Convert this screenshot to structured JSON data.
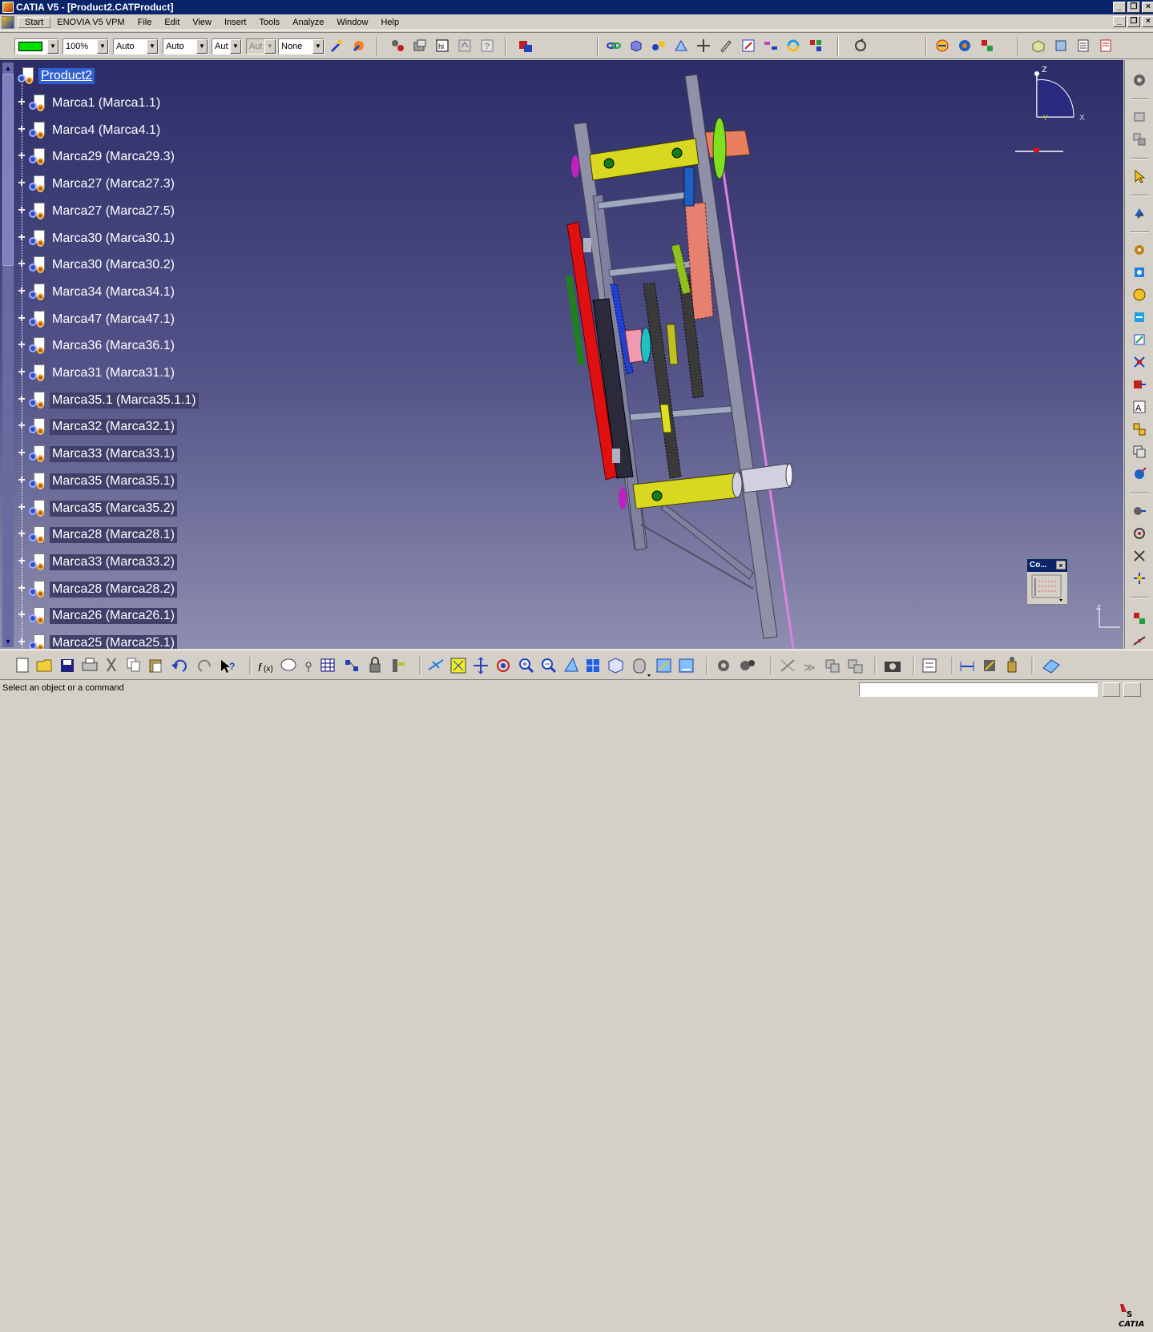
{
  "window": {
    "title": "CATIA V5 - [Product2.CATProduct]"
  },
  "menu": {
    "items": [
      "Start",
      "ENOVIA V5 VPM",
      "File",
      "Edit",
      "View",
      "Insert",
      "Tools",
      "Analyze",
      "Window",
      "Help"
    ]
  },
  "toolbar": {
    "zoom_value": "100%",
    "linetype_value": "Auto",
    "thickness_value": "Auto",
    "layer_value": "Aut",
    "layer2_value": "Aut",
    "render_value": "None",
    "color_value": "#00e000"
  },
  "tree": {
    "root": "Product2",
    "items": [
      "Marca1 (Marca1.1)",
      "Marca4 (Marca4.1)",
      "Marca29 (Marca29.3)",
      "Marca27 (Marca27.3)",
      "Marca27 (Marca27.5)",
      "Marca30 (Marca30.1)",
      "Marca30 (Marca30.2)",
      "Marca34 (Marca34.1)",
      "Marca47 (Marca47.1)",
      "Marca36 (Marca36.1)",
      "Marca31 (Marca31.1)",
      "Marca35.1 (Marca35.1.1)",
      "Marca32 (Marca32.1)",
      "Marca33 (Marca33.1)",
      "Marca35 (Marca35.1)",
      "Marca35 (Marca35.2)",
      "Marca28 (Marca28.1)",
      "Marca33 (Marca33.2)",
      "Marca28 (Marca28.2)",
      "Marca26 (Marca26.1)",
      "Marca25 (Marca25.1)"
    ]
  },
  "compass": {
    "z_label": "Z",
    "x_label": "X",
    "y_label": "Y"
  },
  "compass_panel": {
    "title": "Co...",
    "close": "×"
  },
  "mini_axis": {
    "z_label": "Z"
  },
  "status": {
    "message": "Select an object or a command"
  },
  "logo": {
    "text": "CATIA"
  }
}
